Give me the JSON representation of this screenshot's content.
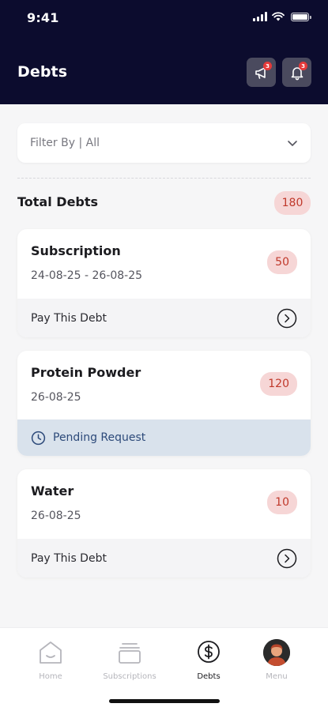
{
  "status_bar": {
    "time": "9:41"
  },
  "header": {
    "title": "Debts",
    "megaphone_badge": "3",
    "bell_badge": "3"
  },
  "filter": {
    "label": "Filter By | All"
  },
  "total": {
    "label": "Total Debts",
    "value": "180"
  },
  "debts": [
    {
      "title": "Subscription",
      "date": "24-08-25 - 26-08-25",
      "amount": "50",
      "action": "Pay This Debt"
    },
    {
      "title": "Protein Powder",
      "date": "26-08-25",
      "amount": "120",
      "action": "Pending Request"
    },
    {
      "title": "Water",
      "date": "26-08-25",
      "amount": "10",
      "action": "Pay This Debt"
    }
  ],
  "tabbar": {
    "items": [
      {
        "label": "Home",
        "icon": "home-icon"
      },
      {
        "label": "Subscriptions",
        "icon": "subscriptions-icon"
      },
      {
        "label": "Debts",
        "icon": "dollar-circle-icon"
      },
      {
        "label": "Menu",
        "icon": "avatar"
      }
    ],
    "active": "Debts"
  },
  "colors": {
    "header_bg": "#0c0c2e",
    "pill_bg": "#f6d6d6",
    "pill_text": "#c0392b",
    "pending_bg": "#d9e2ec",
    "pending_text": "#2d4a7a"
  }
}
